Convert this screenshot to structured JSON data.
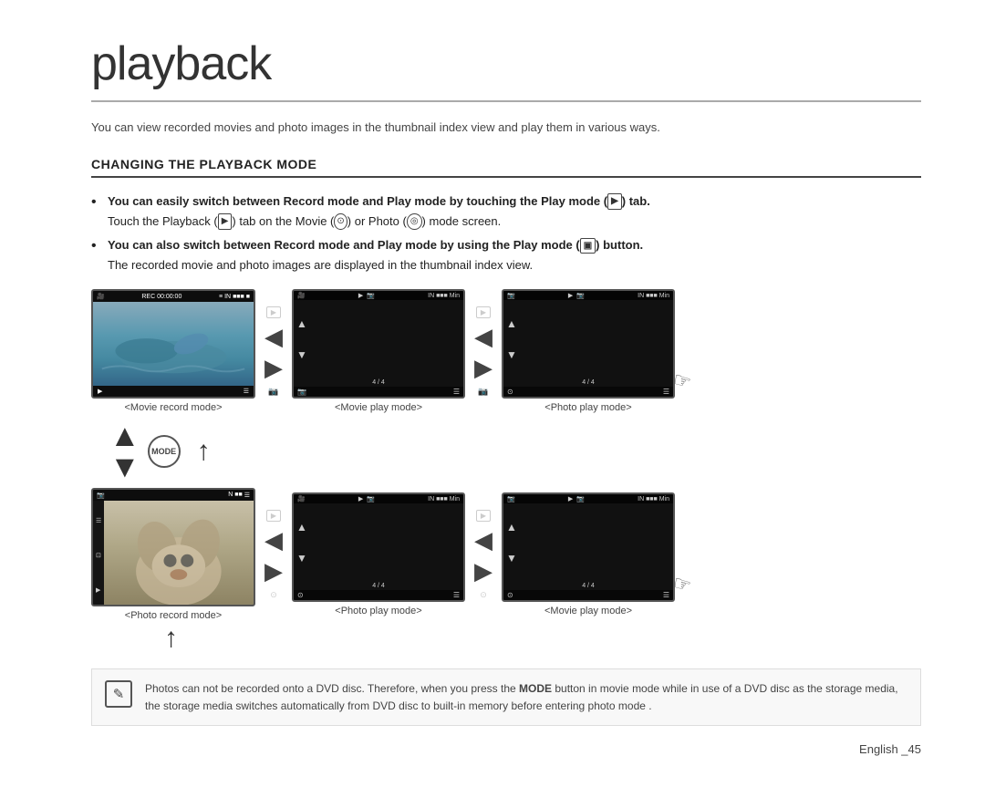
{
  "page": {
    "title": "playback",
    "intro": "You can view recorded movies and photo images in the thumbnail index view and play them in various ways.",
    "section_heading": "CHANGING THE PLAYBACK MODE",
    "bullets": [
      {
        "main": "You can easily switch between Record mode and Play mode by touching the Play mode (▶) tab.",
        "sub": "Touch the Playback (▶) tab on the Movie or Photo mode screen."
      },
      {
        "main": "You can also switch between Record mode and Play mode by using the Play mode (▶) button.",
        "sub": "The recorded movie and photo images are displayed in the thumbnail index view."
      }
    ],
    "labels": {
      "movie_record": "<Movie record mode>",
      "movie_play_top": "<Movie play mode>",
      "photo_play_top": "<Photo play mode>",
      "photo_record": "<Photo record mode>",
      "photo_play_bottom": "<Photo play mode>",
      "movie_play_bottom": "<Movie play mode>"
    },
    "note": "Photos can not be recorded onto a DVD disc. Therefore, when you press the MODE button in movie mode while in use of a DVD disc as the storage media, the storage media switches automatically from DVD disc to built-in memory before entering photo mode .",
    "note_bold": "MODE",
    "footer": "English _45"
  }
}
